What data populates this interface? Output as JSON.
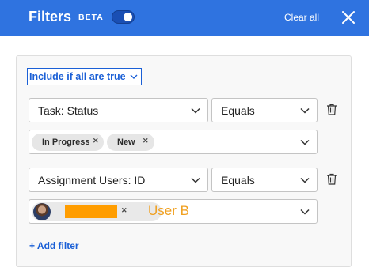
{
  "header": {
    "title": "Filters",
    "beta_label": "BETA",
    "beta_toggle_on": true,
    "clear_all_label": "Clear all",
    "close_icon": "close-icon",
    "background_color": "#2f73e0"
  },
  "filters": {
    "mode_label": "Include if all are true",
    "rows": [
      {
        "field": "Task: Status",
        "operator": "Equals",
        "values": [
          "In Progress",
          "New"
        ]
      },
      {
        "field": "Assignment Users: ID",
        "operator": "Equals",
        "values": [
          {
            "type": "user",
            "avatar": "user-avatar",
            "name_redacted": true,
            "annotation": "User B"
          }
        ]
      }
    ],
    "add_filter_label": "+ Add filter"
  },
  "colors": {
    "accent": "#1a5fd6",
    "redaction": "#ff9d00",
    "annotation": "#f0a020"
  }
}
